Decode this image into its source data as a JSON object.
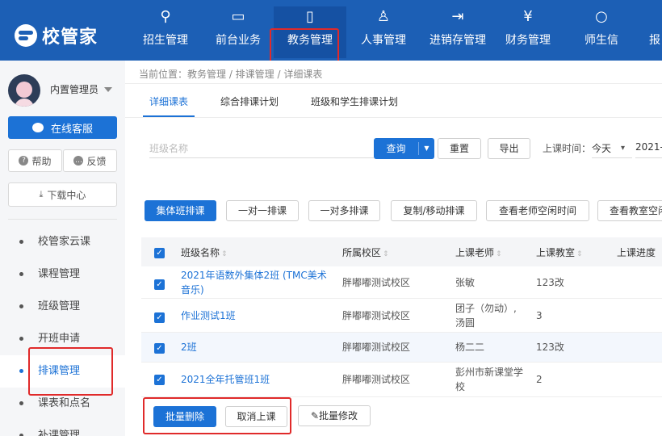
{
  "app": {
    "logo_text": "校管家"
  },
  "top_nav": [
    {
      "label": "招生管理",
      "icon": "user-plus-icon",
      "glyph": "⚲"
    },
    {
      "label": "前台业务",
      "icon": "monitor-icon",
      "glyph": "▭"
    },
    {
      "label": "教务管理",
      "icon": "book-icon",
      "glyph": "▯"
    },
    {
      "label": "人事管理",
      "icon": "person-icon",
      "glyph": "♙"
    },
    {
      "label": "进销存管理",
      "icon": "inventory-icon",
      "glyph": "⇥"
    },
    {
      "label": "财务管理",
      "icon": "money-bag-icon",
      "glyph": "¥"
    },
    {
      "label": "师生信",
      "icon": "message-icon",
      "glyph": "○"
    },
    {
      "label": "报",
      "icon": "report-icon",
      "glyph": ""
    }
  ],
  "sidebar": {
    "user_name": "内置管理员",
    "service_btn": "在线客服",
    "help_btn": "帮助",
    "feedback_btn": "反馈",
    "download_btn": "下载中心",
    "menu": [
      "校管家云课",
      "课程管理",
      "班级管理",
      "开班申请",
      "排课管理",
      "课表和点名",
      "补课管理"
    ]
  },
  "main": {
    "breadcrumb": "当前位置：教务管理 / 排课管理 / 详细课表",
    "tabs": [
      "详细课表",
      "综合排课计划",
      "班级和学生排课计划"
    ],
    "search": {
      "placeholder": "班级名称",
      "value": ""
    },
    "query_btn": "查询",
    "reset_btn": "重置",
    "export_btn": "导出",
    "time_label": "上课时间：",
    "time_select": "今天",
    "date_value": "2021-",
    "actions": [
      "集体班排课",
      "一对一排课",
      "一对多排课",
      "复制/移动排课",
      "查看老师空闲时间",
      "查看教室空闲"
    ],
    "table": {
      "headers": [
        "班级名称",
        "所属校区",
        "上课老师",
        "上课教室",
        "上课进度"
      ],
      "rows": [
        {
          "class_name": "2021年语数外集体2班 (TMC美术音乐)",
          "campus": "胖嘟嘟测试校区",
          "teacher": "张敏",
          "room": "123改"
        },
        {
          "class_name": "作业测试1班",
          "campus": "胖嘟嘟测试校区",
          "teacher": "团子（勿动）,汤圆",
          "room": "3"
        },
        {
          "class_name": "2班",
          "campus": "胖嘟嘟测试校区",
          "teacher": "杨二二",
          "room": "123改"
        },
        {
          "class_name": "2021全年托管班1班",
          "campus": "胖嘟嘟测试校区",
          "teacher": "彭州市新课堂学校",
          "room": "2"
        }
      ]
    },
    "bulk": {
      "delete": "批量删除",
      "cancel": "取消上课",
      "edit": "批量修改"
    }
  }
}
